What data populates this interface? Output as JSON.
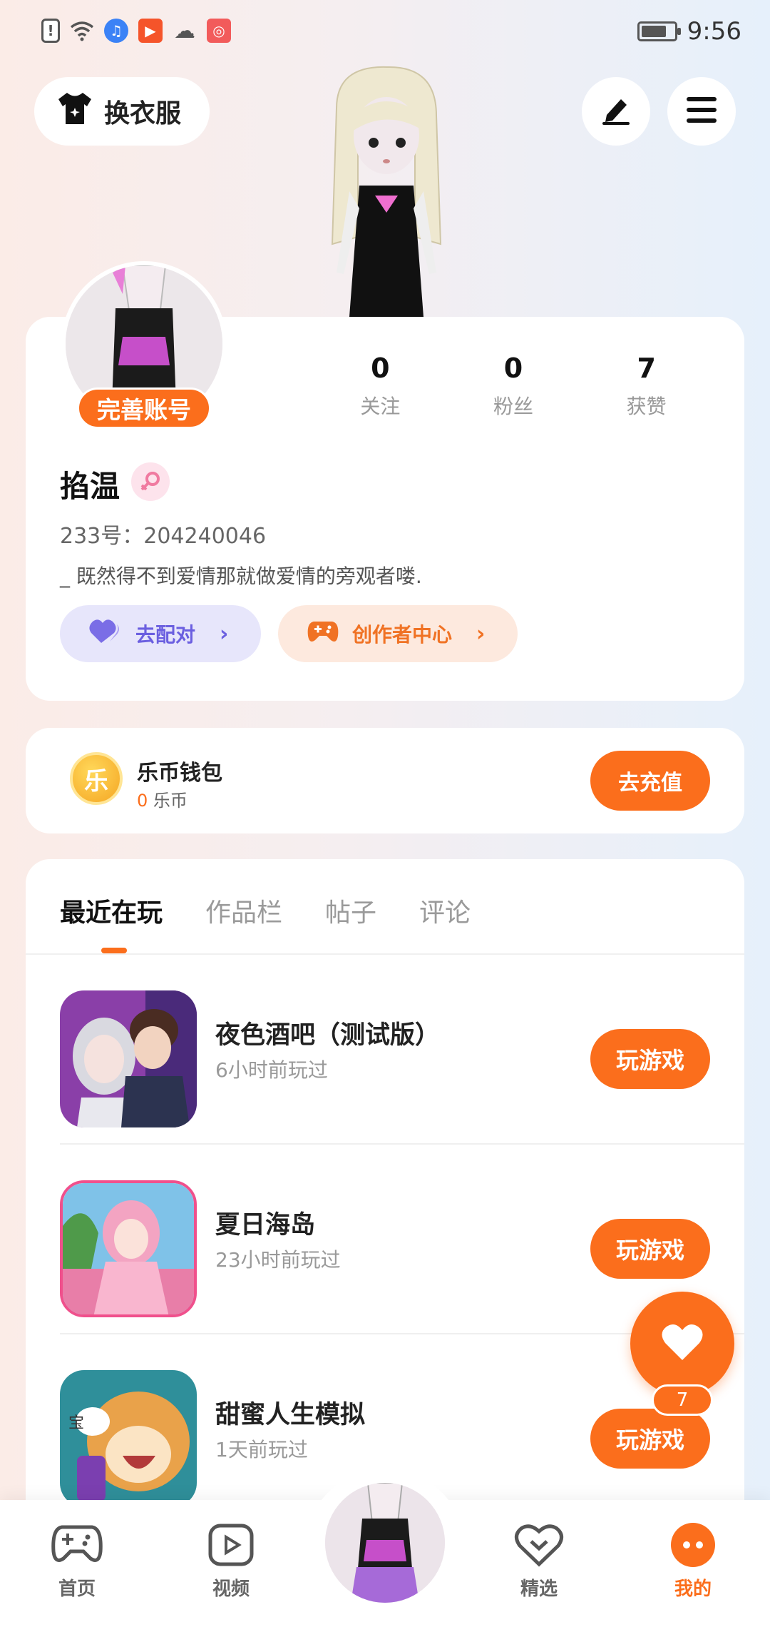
{
  "status_bar": {
    "time": "9:56"
  },
  "header": {
    "outfit_label": "换衣服"
  },
  "profile": {
    "complete_badge": "完善账号",
    "stats": [
      {
        "value": "0",
        "label": "关注"
      },
      {
        "value": "0",
        "label": "粉丝"
      },
      {
        "value": "7",
        "label": "获赞"
      }
    ],
    "nickname": "掐温",
    "uid": "233号：204240046",
    "signature": "_ 既然得不到爱情那就做爱情的旁观者喽.",
    "match_label": "去配对",
    "creator_label": "创作者中心"
  },
  "wallet": {
    "coin_glyph": "乐",
    "title": "乐币钱包",
    "amount": "0",
    "unit": "乐币",
    "recharge_label": "去充值"
  },
  "tabs": [
    "最近在玩",
    "作品栏",
    "帖子",
    "评论"
  ],
  "games": [
    {
      "title": "夜色酒吧（测试版）",
      "time": "6小时前玩过",
      "play": "玩游戏"
    },
    {
      "title": "夏日海岛",
      "time": "23小时前玩过",
      "play": "玩游戏"
    },
    {
      "title": "甜蜜人生模拟",
      "time": "1天前玩过",
      "play": "玩游戏",
      "thumb_text": "宝"
    }
  ],
  "like": {
    "count": "7"
  },
  "nav": {
    "home": "首页",
    "video": "视频",
    "featured": "精选",
    "mine": "我的"
  },
  "colors": {
    "accent": "#fb6e1c",
    "match": "#6b5fe0"
  }
}
